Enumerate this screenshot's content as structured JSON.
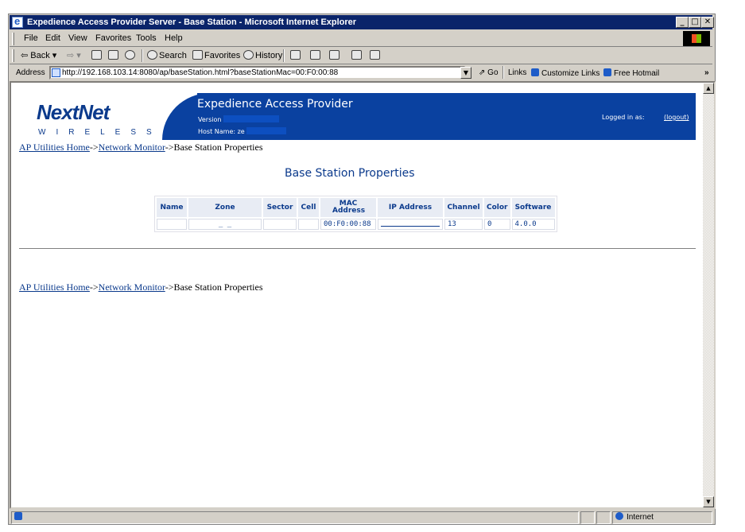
{
  "window": {
    "title": "Expedience Access Provider Server - Base Station - Microsoft Internet Explorer",
    "controls": {
      "minimize": "_",
      "maximize": "□",
      "close": "✕"
    }
  },
  "menu": [
    "File",
    "Edit",
    "View",
    "Favorites",
    "Tools",
    "Help"
  ],
  "toolbar": {
    "back": "⇦ Back ▾",
    "forward": "⇨ ▾",
    "stop_icon": "stop-icon",
    "refresh_icon": "refresh-icon",
    "home_icon": "home-icon",
    "search": "Search",
    "favorites": "Favorites",
    "history": "History"
  },
  "addressbar": {
    "label": "Address",
    "url": "http://192.168.103.14:8080/ap/baseStation.html?baseStationMac=00:F0:00:88",
    "go": "Go",
    "links_label": "Links",
    "links": [
      "Customize Links",
      "Free Hotmail"
    ],
    "chevron": "»"
  },
  "banner": {
    "logo_text": "NextNet",
    "logo_sub": "WIRELESS",
    "title": "Expedience Access Provider",
    "version_label": "Version",
    "host_label": "Host Name: ze",
    "logged_in_label": "Logged in as:",
    "logout": "(logout)"
  },
  "breadcrumb": {
    "home": "AP Utilities Home",
    "sep": "->",
    "monitor": "Network Monitor",
    "current": "Base Station Properties"
  },
  "heading": "Base Station Properties",
  "table": {
    "headers": [
      "Name",
      "Zone",
      "Sector",
      "Cell",
      "MAC Address",
      "IP Address",
      "Channel",
      "Color",
      "Software"
    ],
    "row": [
      "",
      "_ _",
      "",
      "",
      "00:F0:00:88",
      "",
      "13",
      "0",
      "4.0.0"
    ]
  },
  "statusbar": {
    "zone": "Internet"
  },
  "colors": {
    "banner": "#0a41a0",
    "title_bar": "#0a246a",
    "link": "#0b3a8c"
  }
}
